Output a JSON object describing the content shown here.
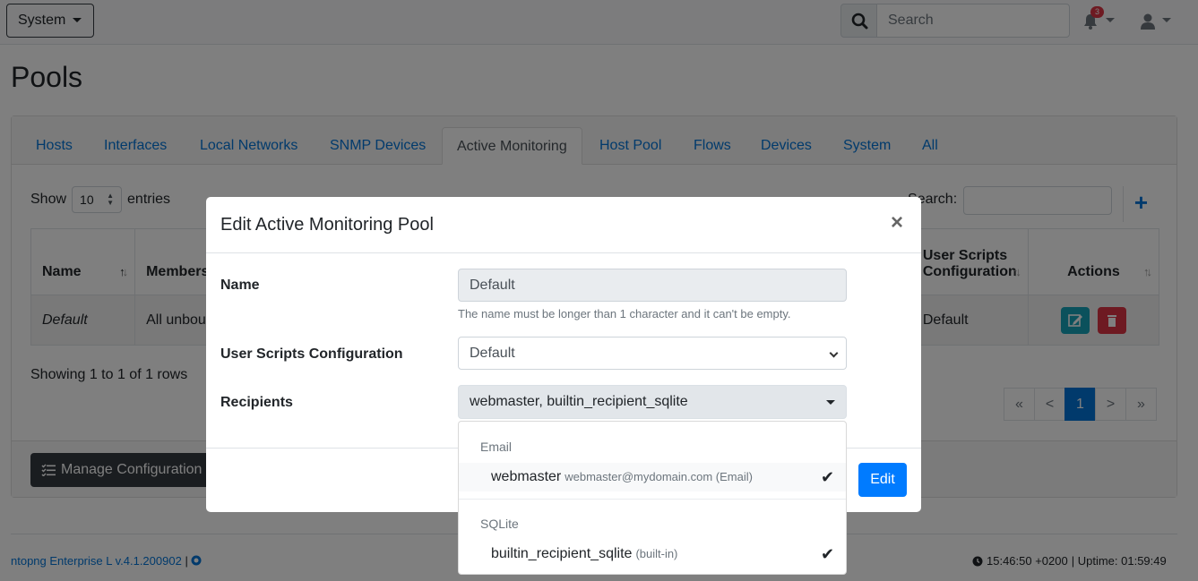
{
  "navbar": {
    "system_label": "System",
    "search_placeholder": "Search",
    "notification_count": "3"
  },
  "page": {
    "title": "Pools"
  },
  "tabs": [
    {
      "label": "Hosts"
    },
    {
      "label": "Interfaces"
    },
    {
      "label": "Local Networks"
    },
    {
      "label": "SNMP Devices"
    },
    {
      "label": "Active Monitoring"
    },
    {
      "label": "Host Pool"
    },
    {
      "label": "Flows"
    },
    {
      "label": "Devices"
    },
    {
      "label": "System"
    },
    {
      "label": "All"
    }
  ],
  "table": {
    "show_label": "Show",
    "entries_value": "10",
    "entries_label": "entries",
    "search_label": "Search:",
    "columns": [
      "Name",
      "Members",
      "User Scripts Configuration",
      "Actions"
    ],
    "rows": [
      {
        "name": "Default",
        "members": "All unbound",
        "config": "Default"
      }
    ],
    "showing_text": "Showing 1 to 1 of 1 rows",
    "pagination": [
      "«",
      "<",
      "1",
      ">",
      "»"
    ],
    "manage_label": "Manage Configuration"
  },
  "footer": {
    "version": "ntopng Enterprise L v.4.1.200902",
    "separator": "|",
    "time": "15:46:50 +0200",
    "uptime": "| Uptime: 01:59:49"
  },
  "modal": {
    "title": "Edit Active Monitoring Pool",
    "close_glyph": "×",
    "name_label": "Name",
    "name_value": "Default",
    "name_help": "The name must be longer than 1 character and it can't be empty.",
    "scripts_label": "User Scripts Configuration",
    "scripts_value": "Default",
    "recipients_label": "Recipients",
    "recipients_value": "webmaster, builtin_recipient_sqlite",
    "edit_label": "Edit"
  },
  "dropdown": {
    "groups": [
      {
        "header": "Email",
        "item": "webmaster",
        "sub": "webmaster@mydomain.com (Email)",
        "check": "✔"
      },
      {
        "header": "SQLite",
        "item": "builtin_recipient_sqlite",
        "sub": "(built-in)",
        "check": "✔"
      }
    ]
  },
  "colors": {
    "primary": "#0275d8",
    "danger": "#dc3545",
    "info": "#17a2b8",
    "dark": "#343a40"
  }
}
